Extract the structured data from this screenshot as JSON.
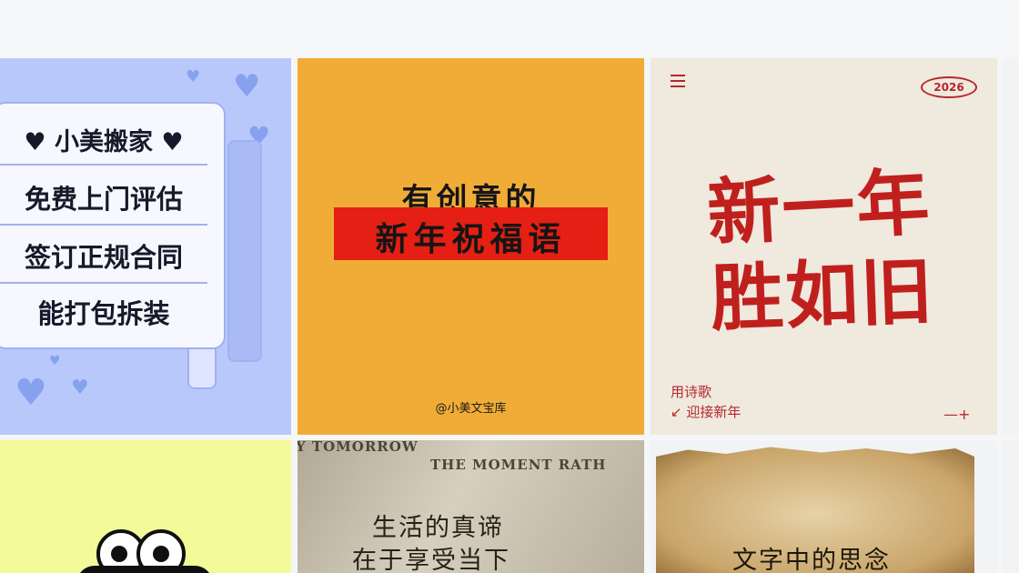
{
  "cards": [
    {
      "lines": [
        "♥ 小美搬家 ♥",
        "免费上门评估",
        "签订正规合同",
        "能打包拆装"
      ]
    },
    {
      "line1": "有创意的",
      "line2": "新年祝福语",
      "credit": "@小美文宝库"
    },
    {
      "year": "2026",
      "title_line1": "新一年",
      "title_line2": "胜如旧",
      "sub1": "用诗歌",
      "sub2": "迎接新年"
    },
    {
      "illustration": "cartoon-eyes"
    },
    {
      "en1": "Y TOMORROW",
      "en2": "THE MOMENT RATH",
      "cn1": "生活的真谛",
      "cn2": "在于享受当下"
    },
    {
      "text": "文字中的思念"
    }
  ],
  "colors": {
    "card1_bg": "#b9c8fb",
    "card2_bg": "#f1ac38",
    "card2_bar": "#e51f13",
    "card3_red": "#c0201d",
    "card4_bg": "#f2fb98"
  }
}
